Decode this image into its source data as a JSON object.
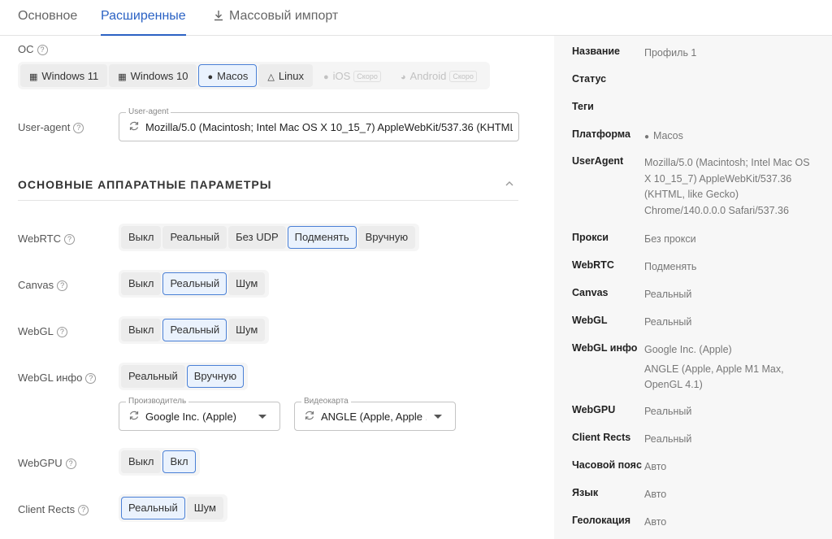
{
  "tabs": [
    {
      "label": "Основное"
    },
    {
      "label": "Расширенные"
    },
    {
      "label": "Массовый импорт"
    }
  ],
  "os": {
    "label": "ОС",
    "options": [
      "Windows 11",
      "Windows 10",
      "Macos",
      "Linux",
      "iOS",
      "Android"
    ],
    "soon_label": "Скоро",
    "selected": "Macos"
  },
  "useragent": {
    "label": "User-agent",
    "legend": "User-agent",
    "value": "Mozilla/5.0 (Macintosh; Intel Mac OS X 10_15_7) AppleWebKit/537.36 (KHTML,..."
  },
  "section": {
    "title": "ОСНОВНЫЕ АППАРАТНЫЕ ПАРАМЕТРЫ"
  },
  "webrtc": {
    "label": "WebRTC",
    "options": [
      "Выкл",
      "Реальный",
      "Без UDP",
      "Подменять",
      "Вручную"
    ],
    "selected": "Подменять"
  },
  "canvas": {
    "label": "Canvas",
    "options": [
      "Выкл",
      "Реальный",
      "Шум"
    ],
    "selected": "Реальный"
  },
  "webgl": {
    "label": "WebGL",
    "options": [
      "Выкл",
      "Реальный",
      "Шум"
    ],
    "selected": "Реальный"
  },
  "webglinfo": {
    "label": "WebGL инфо",
    "options": [
      "Реальный",
      "Вручную"
    ],
    "selected": "Вручную",
    "vendor": {
      "legend": "Производитель",
      "value": "Google Inc. (Apple)"
    },
    "renderer": {
      "legend": "Видеокарта",
      "value": "ANGLE (Apple, Apple ..."
    }
  },
  "webgpu": {
    "label": "WebGPU",
    "options": [
      "Выкл",
      "Вкл"
    ],
    "selected": "Вкл"
  },
  "clientrects": {
    "label": "Client Rects",
    "options": [
      "Реальный",
      "Шум"
    ],
    "selected": "Реальный"
  },
  "summary": {
    "name": {
      "k": "Название",
      "v": "Профиль 1"
    },
    "status": {
      "k": "Статус",
      "v": ""
    },
    "tags": {
      "k": "Теги",
      "v": ""
    },
    "platform": {
      "k": "Платформа",
      "v": "Macos"
    },
    "useragent": {
      "k": "UserAgent",
      "v": "Mozilla/5.0 (Macintosh; Intel Mac OS X 10_15_7) AppleWebKit/537.36 (KHTML, like Gecko) Chrome/140.0.0.0 Safari/537.36"
    },
    "proxy": {
      "k": "Прокси",
      "v": "Без прокси"
    },
    "webrtc": {
      "k": "WebRTC",
      "v": "Подменять"
    },
    "canvas": {
      "k": "Canvas",
      "v": "Реальный"
    },
    "webgl": {
      "k": "WebGL",
      "v": "Реальный"
    },
    "webglinfo": {
      "k": "WebGL инфо",
      "v1": "Google Inc. (Apple)",
      "v2": "ANGLE (Apple, Apple M1 Max, OpenGL 4.1)"
    },
    "webgpu": {
      "k": "WebGPU",
      "v": "Реальный"
    },
    "clientrects": {
      "k": "Client Rects",
      "v": "Реальный"
    },
    "timezone": {
      "k": "Часовой пояс",
      "v": "Авто"
    },
    "language": {
      "k": "Язык",
      "v": "Авто"
    },
    "geo": {
      "k": "Геолокация",
      "v": "Авто"
    }
  }
}
